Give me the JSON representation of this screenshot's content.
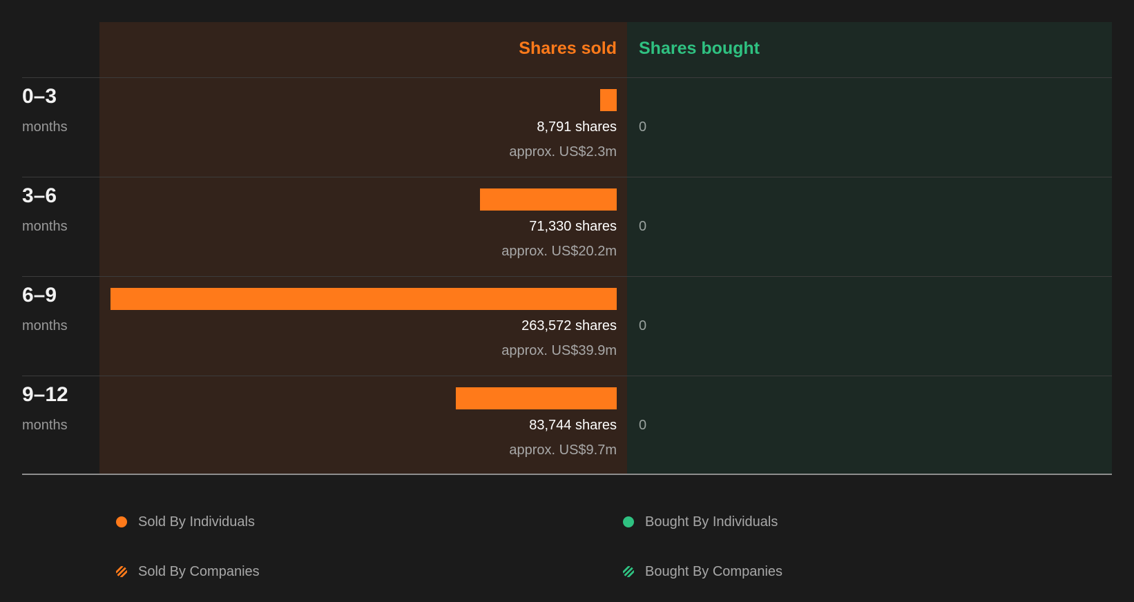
{
  "chart_data": {
    "type": "bar",
    "orientation": "horizontal",
    "headers": {
      "sold": "Shares sold",
      "bought": "Shares bought"
    },
    "period_unit": "months",
    "categories": [
      "0–3",
      "3–6",
      "6–9",
      "9–12"
    ],
    "series": [
      {
        "name": "Shares sold",
        "values": [
          8791,
          71330,
          263572,
          83744
        ],
        "value_labels": [
          "8,791 shares",
          "71,330 shares",
          "263,572 shares",
          "83,744 shares"
        ],
        "approx_labels": [
          "approx. US$2.3m",
          "approx. US$20.2m",
          "approx. US$39.9m",
          "approx. US$9.7m"
        ],
        "color": "#ff7a1a"
      },
      {
        "name": "Shares bought",
        "values": [
          0,
          0,
          0,
          0
        ],
        "value_labels": [
          "0",
          "0",
          "0",
          "0"
        ],
        "color": "#2fc181"
      }
    ],
    "legend": [
      {
        "label": "Sold By Individuals",
        "color": "#ff7a1a",
        "pattern": "solid"
      },
      {
        "label": "Bought By Individuals",
        "color": "#2fc181",
        "pattern": "solid"
      },
      {
        "label": "Sold By Companies",
        "color": "#ff7a1a",
        "pattern": "striped"
      },
      {
        "label": "Bought By Companies",
        "color": "#2fc181",
        "pattern": "striped"
      }
    ],
    "legend_placement": "bottom"
  },
  "colors": {
    "sold_accent": "#ff7a1a",
    "bought_accent": "#2fc181",
    "sold_panel": "#33231b",
    "bought_panel": "#1c2924",
    "background": "#1b1b1b"
  }
}
